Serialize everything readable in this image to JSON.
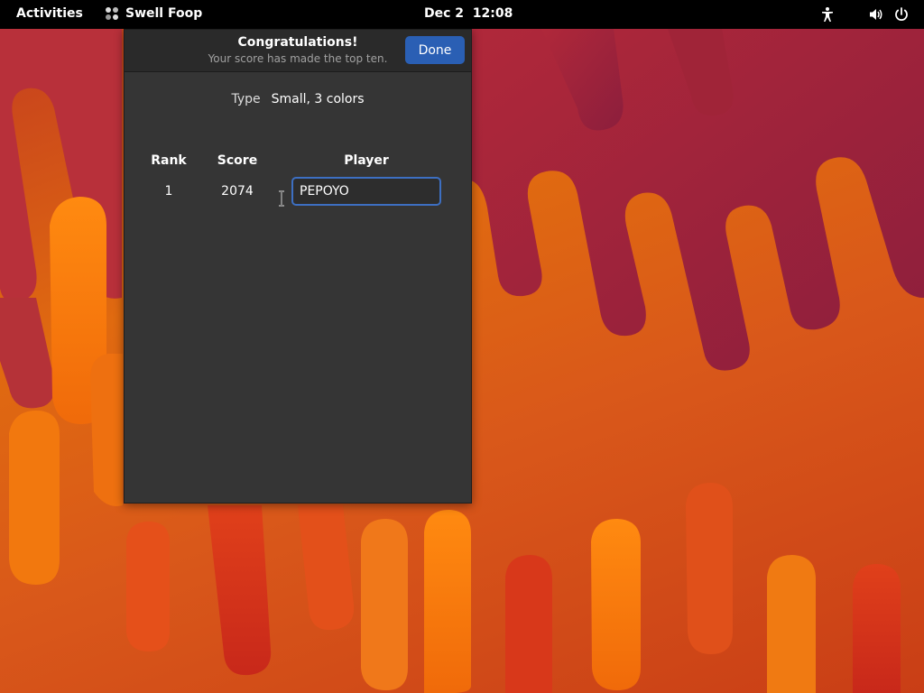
{
  "topbar": {
    "activities": "Activities",
    "app_name": "Swell Foop",
    "clock": "Dec 2  12:08",
    "icons": [
      "accessibility-icon",
      "volume-icon",
      "power-icon"
    ]
  },
  "dialog": {
    "title": "Congratulations!",
    "subtitle": "Your score has made the top ten.",
    "done_label": "Done",
    "type_label": "Type",
    "type_value": "Small, 3 colors",
    "columns": [
      "Rank",
      "Score",
      "Player"
    ],
    "rows": [
      {
        "rank": "1",
        "score": "2074",
        "player": "PEPOYO"
      }
    ]
  },
  "colors": {
    "accent": "#2a5fb4",
    "dialog_bg": "#353535",
    "header_bg": "#2a2a2a"
  }
}
